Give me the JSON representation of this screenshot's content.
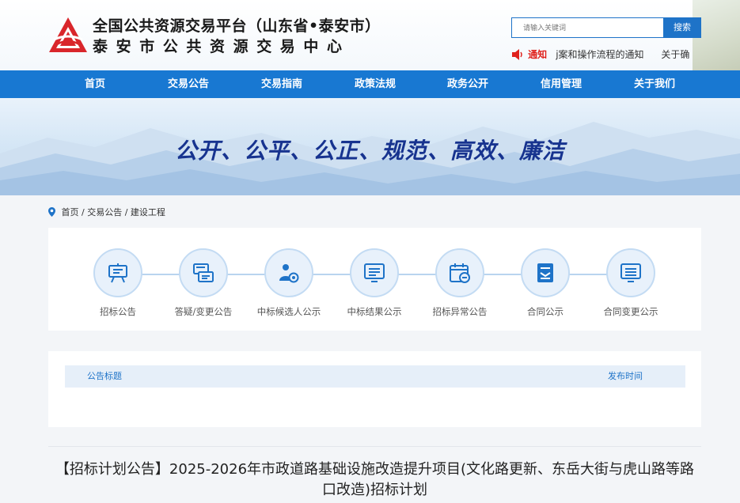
{
  "header": {
    "title": "全国公共资源交易平台（山东省•泰安市）",
    "subtitle": "泰安市公共资源交易中心",
    "search": {
      "placeholder": "请输入关键词",
      "button_label": "搜索"
    },
    "notice": {
      "label": "通知",
      "items": [
        "j案和操作流程的通知",
        "关于确"
      ]
    }
  },
  "nav": {
    "items": [
      "首页",
      "交易公告",
      "交易指南",
      "政策法规",
      "政务公开",
      "信用管理",
      "关于我们"
    ]
  },
  "banner": {
    "slogan": "公开、公平、公正、规范、高效、廉洁"
  },
  "breadcrumb": {
    "items": [
      "首页",
      "交易公告",
      "建设工程"
    ],
    "separator": " / "
  },
  "categories": [
    {
      "label": "招标公告",
      "icon": "easel-icon"
    },
    {
      "label": "答疑/变更公告",
      "icon": "exchange-icon"
    },
    {
      "label": "中标候选人公示",
      "icon": "candidate-icon"
    },
    {
      "label": "中标结果公示",
      "icon": "result-list-icon"
    },
    {
      "label": "招标异常公告",
      "icon": "calendar-minus-icon"
    },
    {
      "label": "合同公示",
      "icon": "contract-icon"
    },
    {
      "label": "合同变更公示",
      "icon": "contract-change-icon"
    }
  ],
  "list": {
    "col_title": "公告标题",
    "col_date": "发布时间"
  },
  "article": {
    "title": "【招标计划公告】2025-2026年市政道路基础设施改造提升项目(文化路更新、东岳大街与虎山路等路口改造)招标计划"
  },
  "colors": {
    "primary": "#1878d2",
    "accent_red": "#e0221d",
    "slogan": "#17338f"
  }
}
